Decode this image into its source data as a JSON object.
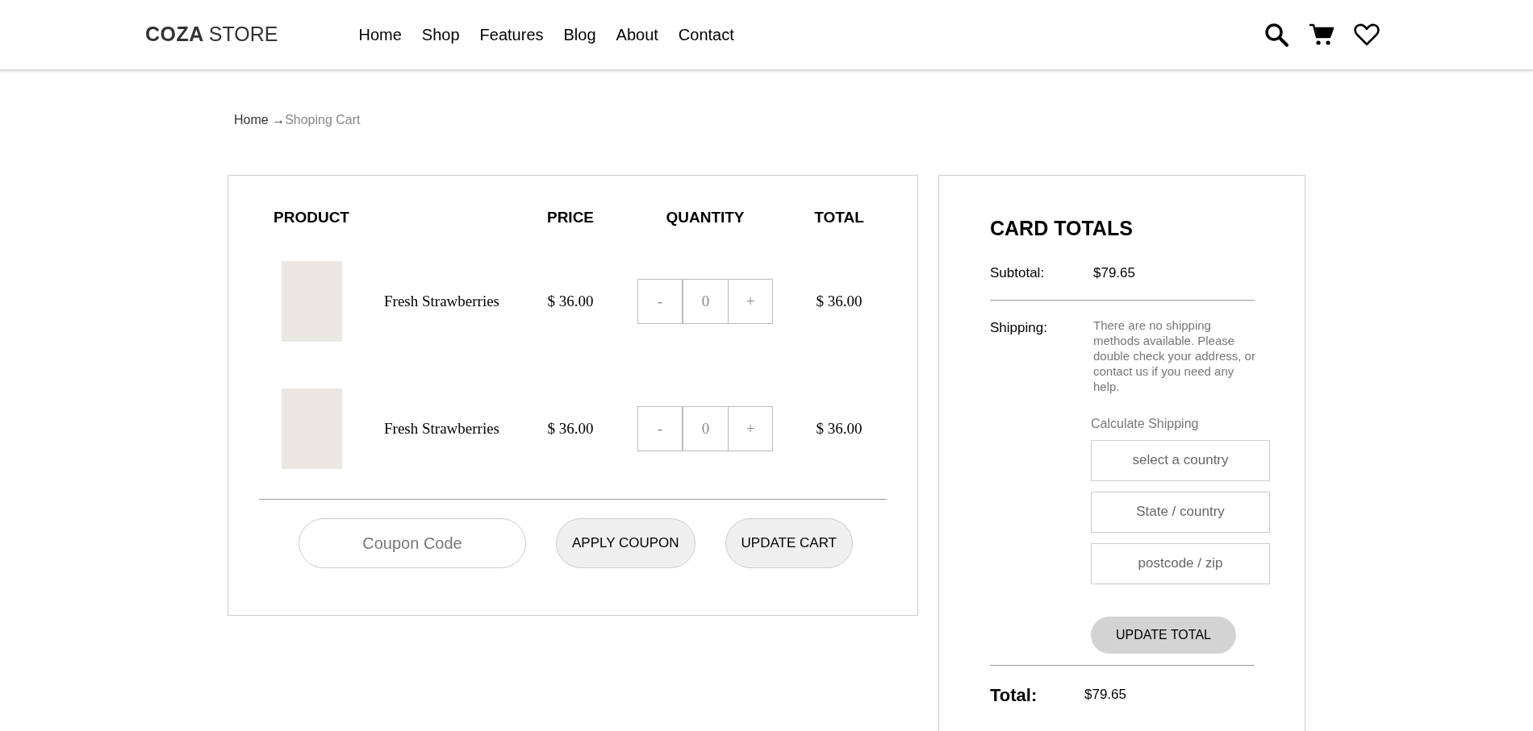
{
  "header": {
    "logo_bold": "COZA",
    "logo_light": "STORE",
    "nav": [
      {
        "label": "Home"
      },
      {
        "label": "Shop"
      },
      {
        "label": "Features"
      },
      {
        "label": "Blog"
      },
      {
        "label": "About"
      },
      {
        "label": "Contact"
      }
    ]
  },
  "breadcrumb": {
    "home": "Home",
    "separator": "→",
    "current": "Shoping Cart"
  },
  "cart": {
    "columns": [
      "PRODUCT",
      "PRICE",
      "QUANTITY",
      "TOTAL"
    ],
    "rows": [
      {
        "name": "Fresh Strawberries",
        "price": "$ 36.00",
        "minus": "-",
        "quantity": "0",
        "plus": "+",
        "total": "$ 36.00"
      },
      {
        "name": "Fresh Strawberries",
        "price": "$ 36.00",
        "minus": "-",
        "quantity": "0",
        "plus": "+",
        "total": "$ 36.00"
      }
    ],
    "coupon": {
      "placeholder": "Coupon Code"
    },
    "buttons": [
      "APPLY COUPON",
      "UPDATE CART"
    ]
  },
  "totals": {
    "title": "CARD TOTALS",
    "subtotal_label": "Subtotal:",
    "subtotal": "$79.65",
    "shipping_label": "Shipping:",
    "shipping_note": "There are no shipping methods available. Please double check your address, or contact us if you need any help.",
    "calculate_label": "Calculate Shipping",
    "fields": [
      {
        "placeholder": "select a country"
      },
      {
        "placeholder": "State / country"
      },
      {
        "placeholder": "postcode / zip"
      }
    ],
    "update_button": "UPDATE TOTAL",
    "total_label": "Total:",
    "total": "$79.65"
  }
}
